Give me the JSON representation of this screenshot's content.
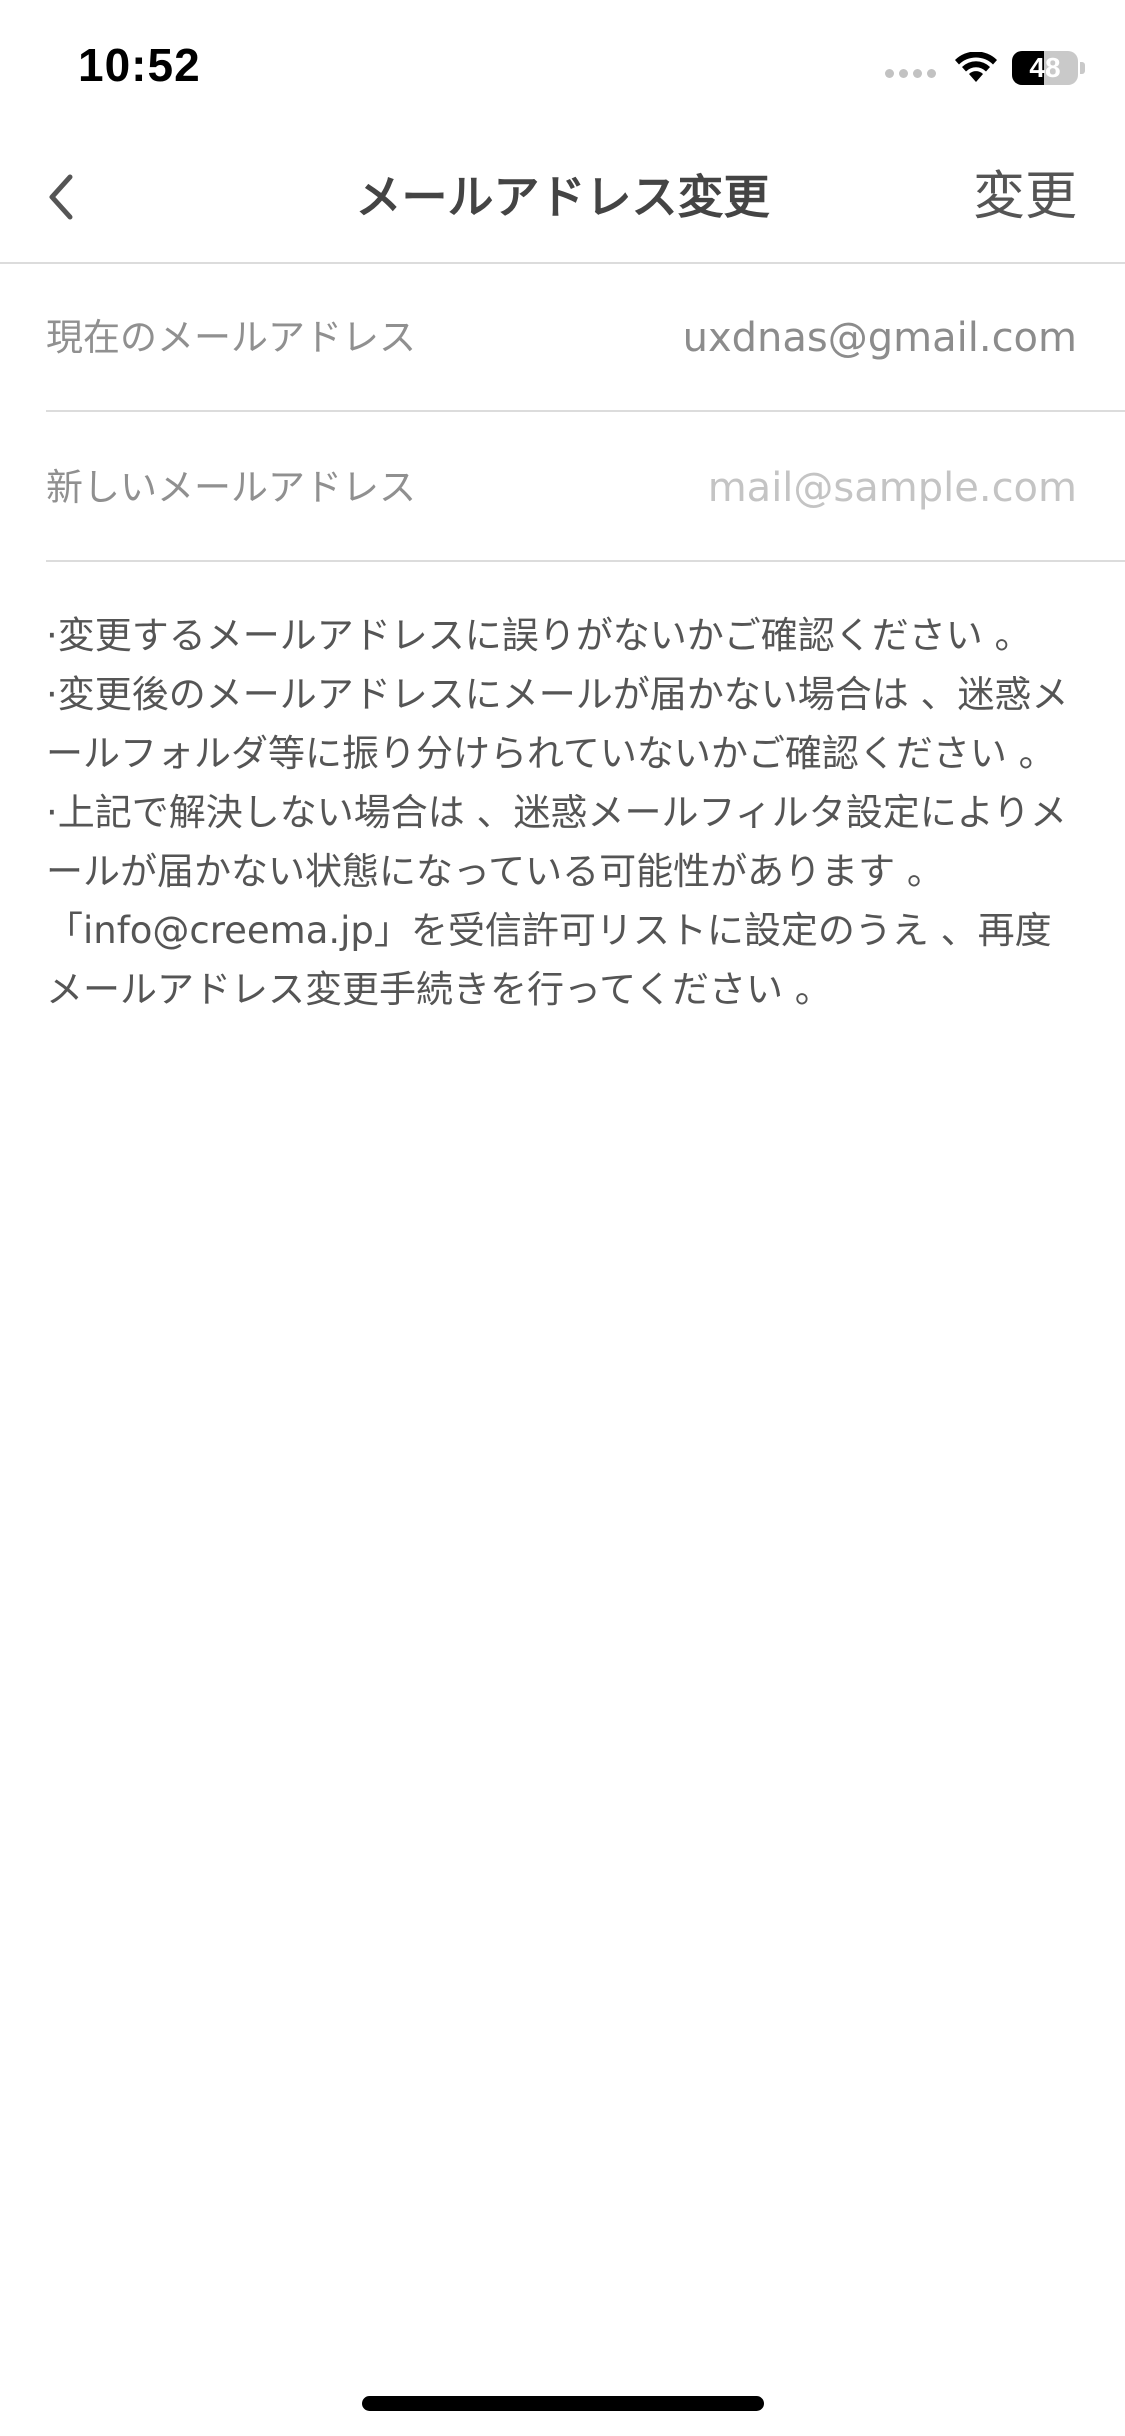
{
  "status_bar": {
    "time": "10:52",
    "battery_level": "48",
    "battery_fraction": 0.48
  },
  "nav": {
    "title": "メールアドレス変更",
    "action_label": "変更",
    "back_icon": "chevron-left-icon"
  },
  "form": {
    "current_email": {
      "label": "現在のメールアドレス",
      "value": "uxdnas@gmail.com"
    },
    "new_email": {
      "label": "新しいメールアドレス",
      "value": "",
      "placeholder": "mail@sample.com"
    }
  },
  "notes": [
    "·変更するメールアドレスに誤りがないかご確認ください 。",
    "·変更後のメールアドレスにメールが届かない場合は 、迷惑メールフォルダ等に振り分けられていないかご確認ください 。",
    "·上記で解決しない場合は 、迷惑メールフィルタ設定によりメールが届かない状態になっている可能性があります 。「info@creema.jp」を受信許可リストに設定のうえ 、再度メールアドレス変更手続きを行ってください 。"
  ]
}
